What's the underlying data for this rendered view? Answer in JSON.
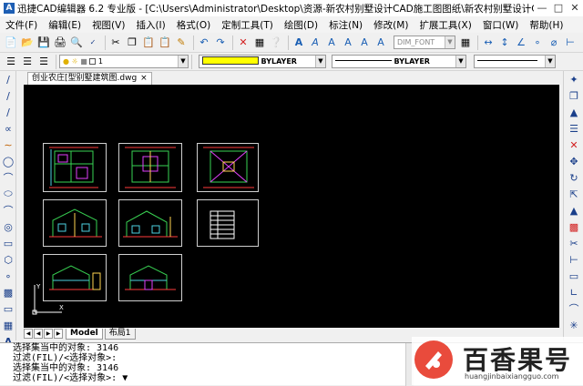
{
  "window": {
    "title": "迅捷CAD编辑器 6.2 专业版 - [C:\\Users\\Administrator\\Desktop\\资源-新农村别墅设计CAD施工图图纸\\新农村别墅设计CAD施",
    "app_icon": "A"
  },
  "menu": [
    "文件(F)",
    "编辑(E)",
    "视图(V)",
    "插入(I)",
    "格式(O)",
    "定制工具(T)",
    "绘图(D)",
    "标注(N)",
    "修改(M)",
    "扩展工具(X)",
    "窗口(W)",
    "帮助(H)"
  ],
  "toolbar": {
    "dimstyle": "DIM_FONT",
    "layer_value": "1",
    "color_value": "BYLAYER",
    "linetype_value": "BYLAYER",
    "lineweight_value": ""
  },
  "document_tab": {
    "label": "创业农庄[型别墅建筑图.dwg",
    "close": "×"
  },
  "layout_tabs": [
    "Model",
    "布局1"
  ],
  "ucs": {
    "x_label": "X",
    "y_label": "Y"
  },
  "command_lines": [
    "选择集当中的对象: 3146",
    "过滤(FIL)/<选择对象>:",
    "选择集当中的对象: 3146",
    "过滤(FIL)/<选择对象>: ▼"
  ],
  "watermark": {
    "title": "百香果号",
    "url": "huangjinbaixiangguo.com"
  },
  "colors": {
    "canvas_bg": "#000000",
    "drawing_green": "#39d353",
    "drawing_magenta": "#e040fb",
    "drawing_yellow": "#ffd54f",
    "drawing_red": "#ff3b3b",
    "drawing_cyan": "#4dd0e1",
    "color_swatch": "#ffff00"
  }
}
